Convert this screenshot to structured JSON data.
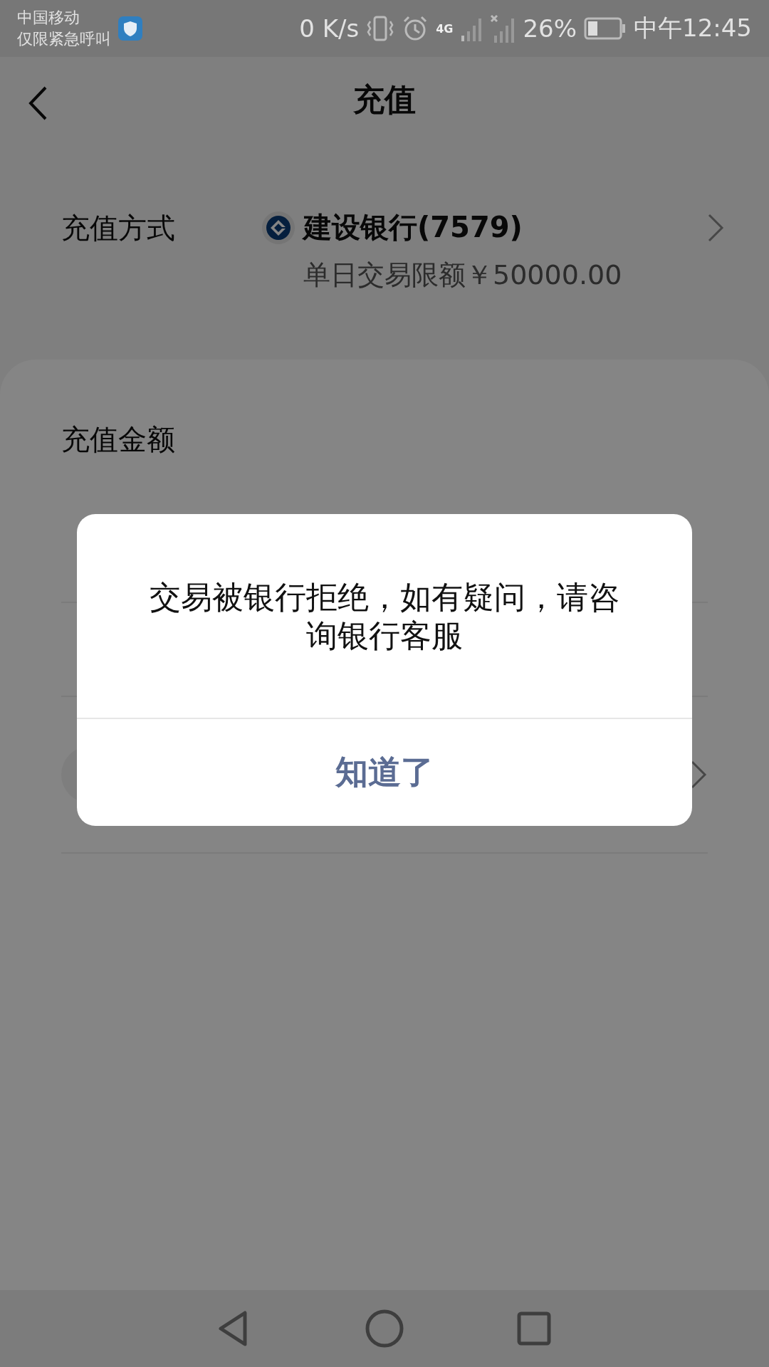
{
  "status_bar": {
    "carrier": "中国移动",
    "carrier_note": "仅限紧急呼叫",
    "speed": "0 K/s",
    "network": "4G",
    "battery": "26%",
    "time": "中午12:45"
  },
  "header": {
    "title": "充值"
  },
  "payment_method": {
    "label": "充值方式",
    "bank": "建设银行(7579)",
    "limit": "单日交易限额￥50000.00"
  },
  "amount": {
    "label": "充值金额"
  },
  "dialog": {
    "message": "交易被银行拒绝，如有疑问，请咨询银行客服",
    "button": "知道了"
  }
}
